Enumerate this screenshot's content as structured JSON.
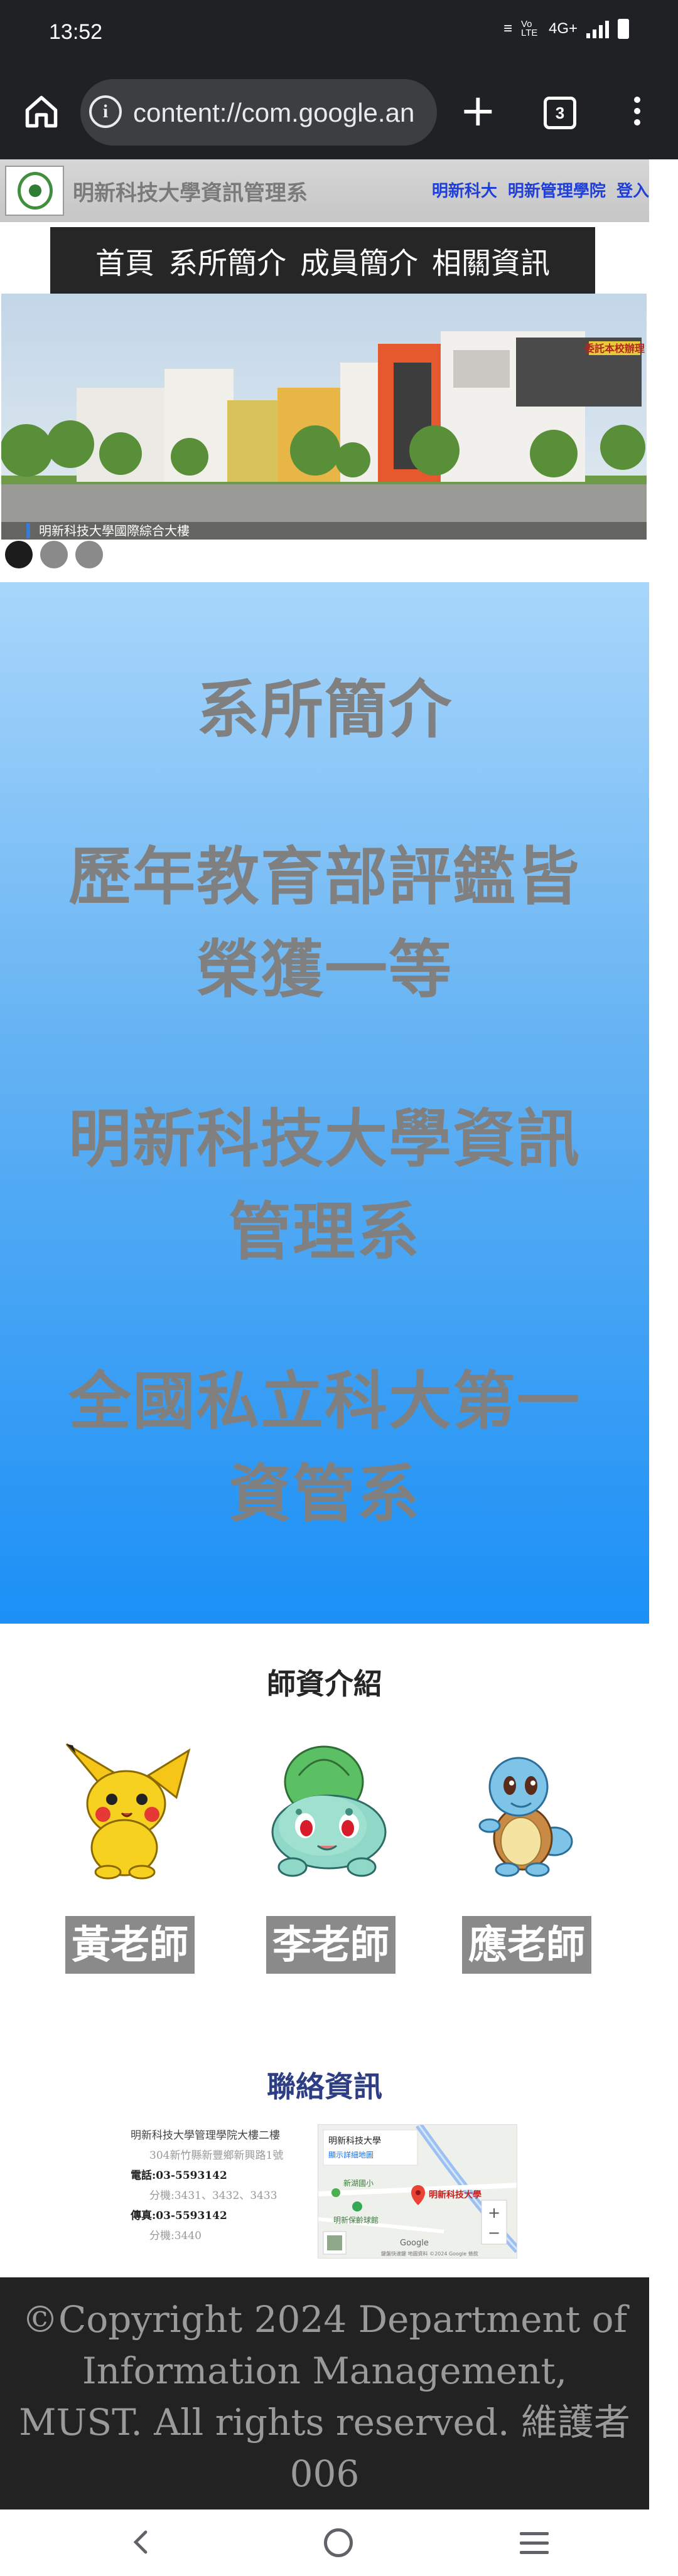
{
  "status_bar": {
    "time": "13:52",
    "network": "4G+",
    "volte": "Vo LTE"
  },
  "browser": {
    "url": "content://com.google.an",
    "tab_count": "3",
    "icons": [
      "home-icon",
      "info-icon",
      "plus-icon",
      "tabs-icon",
      "more-icon"
    ]
  },
  "header": {
    "site_title": "明新科技大學資訊管理系",
    "link_school": "明新科大",
    "link_college": "明新管理學院",
    "link_login": "登入"
  },
  "nav": {
    "items": [
      "首頁",
      "系所簡介",
      "成員簡介",
      "相關資訊"
    ]
  },
  "banner": {
    "badge": "委託本校辦理",
    "caption": "明新科技大學國際綜合大樓",
    "slides": 3,
    "active_slide": 1
  },
  "intro": {
    "lines": [
      "系所簡介",
      "歷年教育部評鑑皆榮獲一等",
      "明新科技大學資訊管理系",
      "全國私立科大第一資管系"
    ]
  },
  "teachers": {
    "title": "師資介紹",
    "list": [
      {
        "name": "黃老師",
        "image": "pikachu-image"
      },
      {
        "name": "李老師",
        "image": "bulbasaur-image"
      },
      {
        "name": "應老師",
        "image": "squirtle-image"
      }
    ]
  },
  "contact": {
    "title": "聯絡資訊",
    "dept_line": "明新科技大學管理學院大樓二樓",
    "address": "304新竹縣新豐鄉新興路1號",
    "phone_label": "電話:",
    "phone": "03-5593142",
    "phone_ext": "分機:3431、3432、3433",
    "fax_label": "傳真:",
    "fax": "03-5593142",
    "fax_ext": "分機:3440",
    "map": {
      "place_name": "明新科技大學",
      "place_link": "顯示詳細地圖",
      "marker_label": "明新科技大學",
      "poi1": "新湖國小",
      "poi2": "明新保齡球館",
      "logo": "Google",
      "attribution": "鍵盤快速鍵  地圖資料 ©2024 Google  條款"
    }
  },
  "footer": {
    "text": "©Copyright 2024 Department of Information Management, MUST. All rights reserved. 維護者006"
  },
  "colors": {
    "accent_link": "#1f3fd8",
    "footer_bg": "#222222",
    "intro_gradient_top": "#a8d6fb",
    "intro_gradient_bottom": "#1b90f6"
  }
}
